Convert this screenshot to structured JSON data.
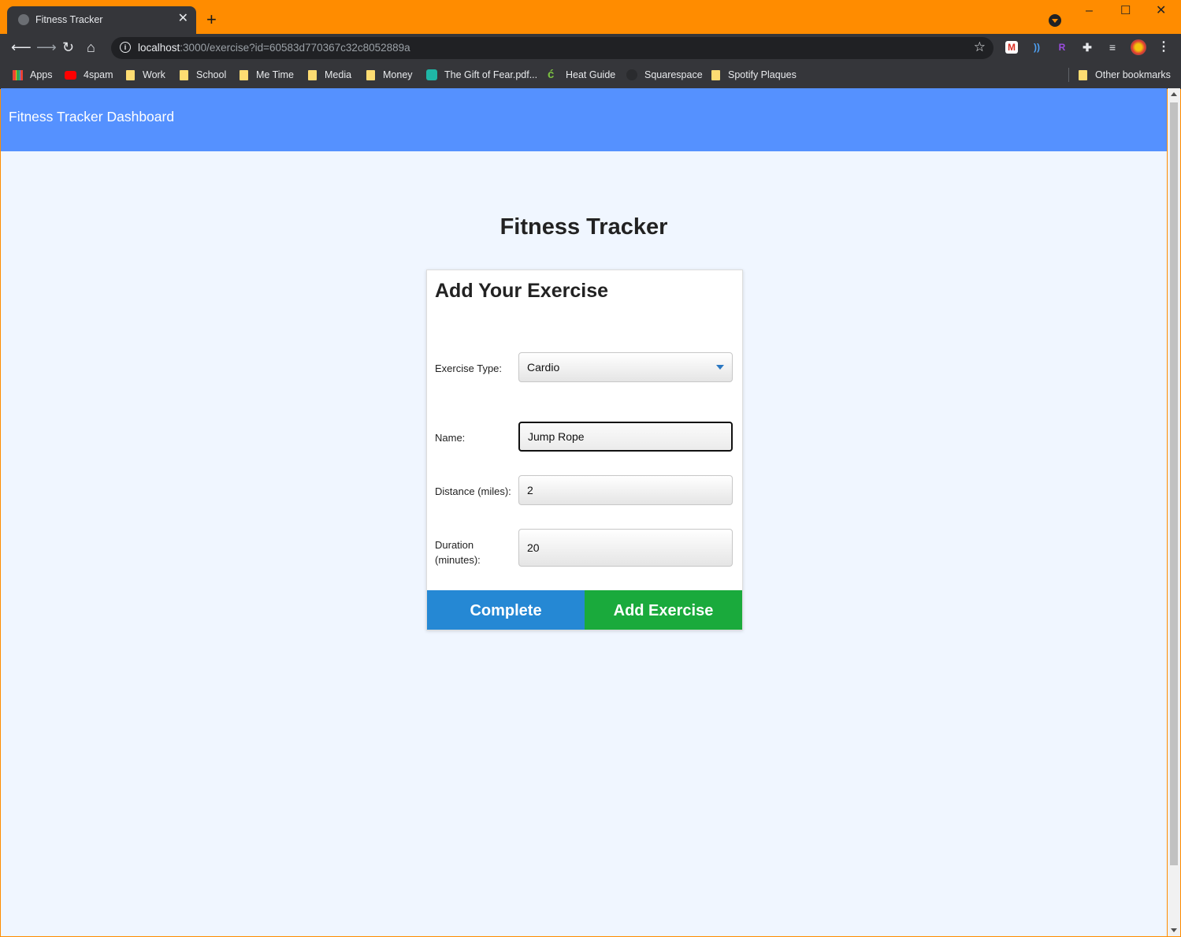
{
  "browser": {
    "tab_title": "Fitness Tracker",
    "url_host": "localhost",
    "url_path": ":3000/exercise?id=60583d770367c32c8052889a",
    "bookmarks": [
      {
        "label": "Apps",
        "icon": "apps-grid-icon"
      },
      {
        "label": "4spam",
        "icon": "youtube-icon"
      },
      {
        "label": "Work",
        "icon": "folder-icon"
      },
      {
        "label": "School",
        "icon": "folder-icon"
      },
      {
        "label": "Me Time",
        "icon": "folder-icon"
      },
      {
        "label": "Media",
        "icon": "folder-icon"
      },
      {
        "label": "Money",
        "icon": "folder-icon"
      },
      {
        "label": "The Gift of Fear.pdf...",
        "icon": "document-icon"
      },
      {
        "label": "Heat Guide",
        "icon": "leaf-icon"
      },
      {
        "label": "Squarespace",
        "icon": "squarespace-icon"
      },
      {
        "label": "Spotify Plaques",
        "icon": "folder-icon"
      }
    ],
    "other_bookmarks": "Other bookmarks"
  },
  "page": {
    "navbar_brand": "Fitness Tracker Dashboard",
    "title": "Fitness Tracker",
    "card_title": "Add Your Exercise",
    "form": {
      "exercise_type_label": "Exercise Type:",
      "exercise_type_value": "Cardio",
      "name_label": "Name:",
      "name_value": "Jump Rope",
      "distance_label": "Distance (miles):",
      "distance_value": "2",
      "duration_label": "Duration (minutes):",
      "duration_value": "20"
    },
    "buttons": {
      "complete": "Complete",
      "add_exercise": "Add Exercise"
    }
  },
  "colors": {
    "titlebar": "#ff8c00",
    "navbar": "#5591ff",
    "complete_button": "#2588d4",
    "add_button": "#1aaa3c",
    "page_background": "#f0f6ff"
  }
}
